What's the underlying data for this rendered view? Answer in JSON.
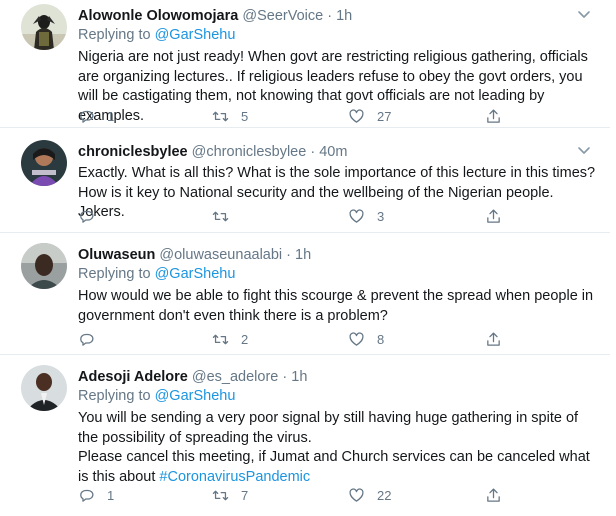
{
  "tweets": [
    {
      "name": "Alowonle Olowomojara",
      "handle": "@SeerVoice",
      "time": "1h",
      "replying_label": "Replying to",
      "replying_to": "@GarShehu",
      "text": "Nigeria are not  just ready! When govt are restricting religious gathering, officials are organizing lectures.. If religious leaders refuse to obey the govt orders, you will be castigating them, not knowing that govt officials are not leading by examples.",
      "replies": "1",
      "retweets": "5",
      "likes": "27"
    },
    {
      "name": "chroniclesbylee",
      "handle": "@chroniclesbylee",
      "time": "40m",
      "text": "Exactly. What is all this? What is the sole importance of this lecture in this times? How is it key to National security and the wellbeing of the Nigerian people. Jokers.",
      "replies": "",
      "retweets": "",
      "likes": "3"
    },
    {
      "name": "Oluwaseun",
      "handle": "@oluwaseunaalabi",
      "time": "1h",
      "replying_label": "Replying to",
      "replying_to": "@GarShehu",
      "text": "How would we be able to fight this scourge & prevent the spread when people in government don't even think there is a problem?",
      "replies": "",
      "retweets": "2",
      "likes": "8"
    },
    {
      "name": "Adesoji Adelore",
      "handle": "@es_adelore",
      "time": "1h",
      "replying_label": "Replying to",
      "replying_to": "@GarShehu",
      "text_line1": "You will be sending a very poor signal by still having huge gathering in spite of the possibility of spreading the virus.",
      "text_line2": "Please cancel this meeting, if Jumat and Church services can be canceled what is this about ",
      "hashtag": "#CoronavirusPandemic",
      "replies": "1",
      "retweets": "7",
      "likes": "22"
    }
  ],
  "icons": {
    "reply": "reply-icon",
    "retweet": "retweet-icon",
    "like": "heart-icon",
    "share": "share-icon",
    "caret": "chevron-down-icon"
  },
  "separator": "·",
  "colors": {
    "link": "#1b95e0",
    "muted": "#657786",
    "border": "#e6ecf0"
  }
}
